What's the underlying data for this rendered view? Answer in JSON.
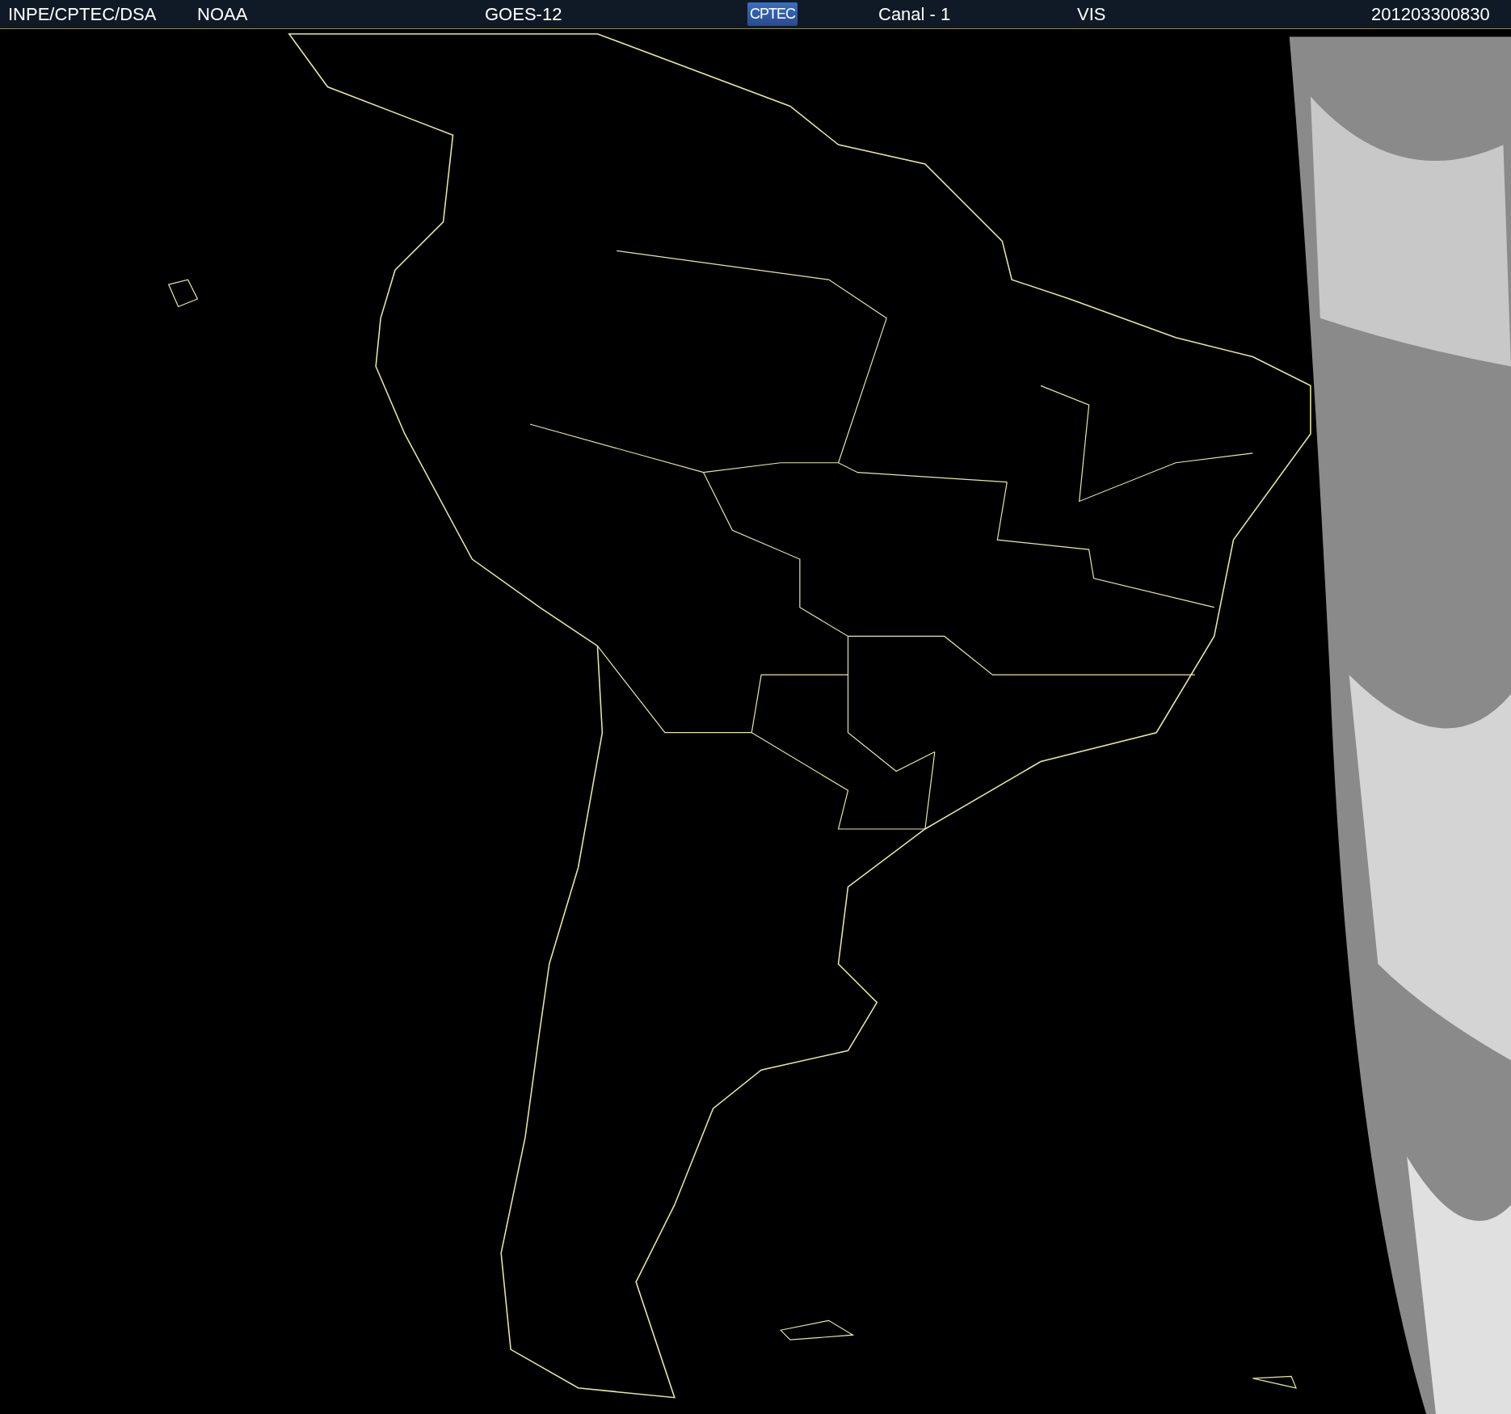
{
  "header": {
    "items": [
      {
        "kind": "text",
        "text": "INPE/CPTEC/DSA"
      },
      {
        "kind": "text",
        "text": "NOAA"
      },
      {
        "kind": "text",
        "text": "GOES-12"
      },
      {
        "kind": "logo",
        "text": "CPTEC"
      },
      {
        "kind": "text",
        "text": "Canal - 1"
      },
      {
        "kind": "text",
        "text": "VIS"
      },
      {
        "kind": "text",
        "text": "201203300830"
      }
    ]
  }
}
